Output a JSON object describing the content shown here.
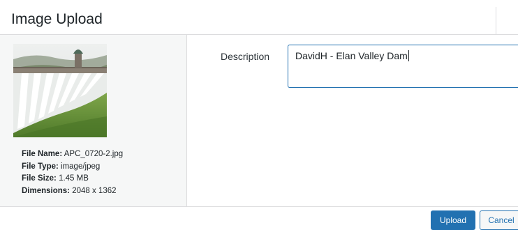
{
  "modal": {
    "title": "Image Upload"
  },
  "file": {
    "name_label": "File Name:",
    "name": "APC_0720-2.jpg",
    "type_label": "File Type:",
    "type": "image/jpeg",
    "size_label": "File Size:",
    "size": "1.45 MB",
    "dimensions_label": "Dimensions:",
    "dimensions": "2048 x 1362"
  },
  "form": {
    "description_label": "Description",
    "description_value": "DavidH - Elan Valley Dam"
  },
  "buttons": {
    "upload": "Upload",
    "cancel": "Cancel"
  },
  "colors": {
    "primary": "#2271b1",
    "sidebar_bg": "#f6f7f7",
    "border": "#dcdcde"
  },
  "icons": {
    "thumbnail": "dam-photo-thumbnail"
  }
}
